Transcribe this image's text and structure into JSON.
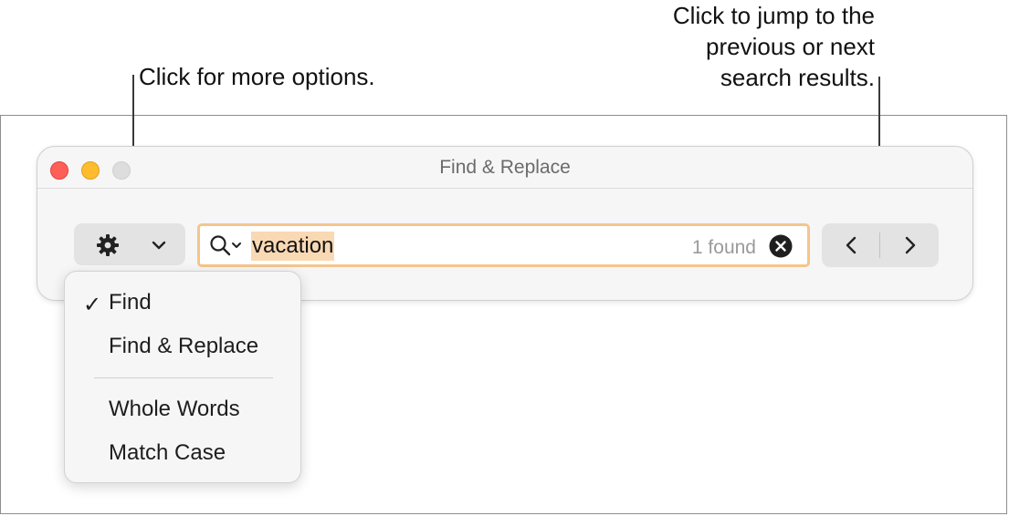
{
  "callouts": {
    "options": "Click for more options.",
    "navigation": [
      "Click to jump to the",
      "previous or next",
      "search results."
    ]
  },
  "window": {
    "title": "Find & Replace"
  },
  "search": {
    "query": "vacation",
    "result_count": "1 found"
  },
  "menu": {
    "items": [
      {
        "label": "Find",
        "checked": true
      },
      {
        "label": "Find & Replace",
        "checked": false
      },
      {
        "label": "Whole Words",
        "checked": false
      },
      {
        "label": "Match Case",
        "checked": false
      }
    ],
    "check_glyph": "✓"
  },
  "icons": {
    "options": "gear-icon",
    "dropdown": "chevron-down-icon",
    "search": "magnifier-icon",
    "clear": "clear-icon",
    "previous": "chevron-left-icon",
    "next": "chevron-right-icon"
  },
  "colors": {
    "close": "#ff5f57",
    "minimize": "#febc2e",
    "zoom_inactive": "#dddddd",
    "search_focus_ring": "#f4c58c",
    "match_highlight": "#f9d9b4"
  }
}
